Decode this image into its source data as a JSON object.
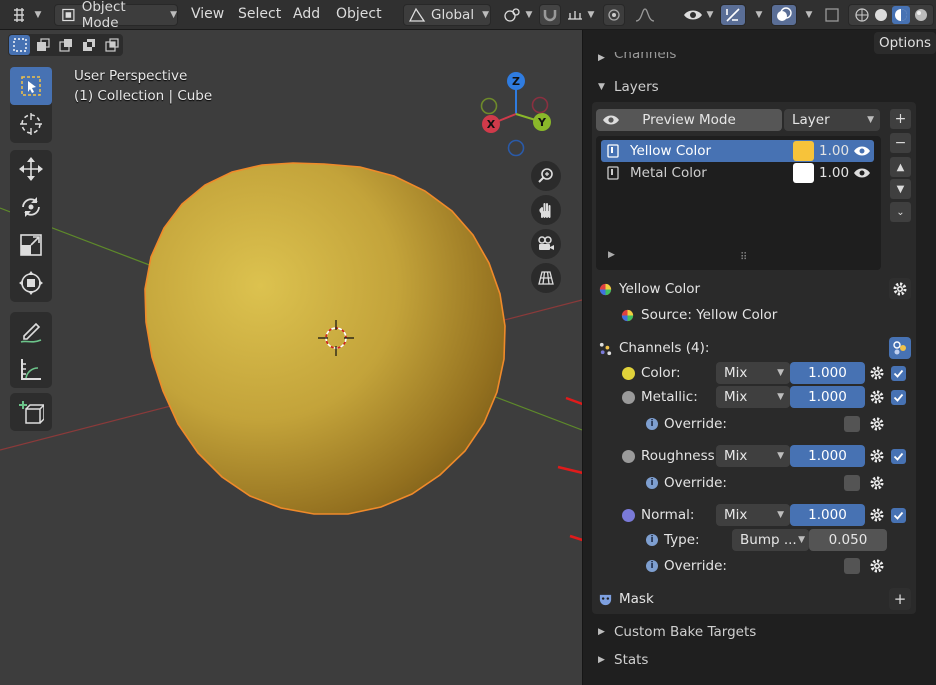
{
  "header": {
    "mode_label": "Object Mode",
    "menus": [
      "View",
      "Select",
      "Add",
      "Object"
    ],
    "orientation_label": "Global"
  },
  "viewport": {
    "perspective_label": "User Perspective",
    "collection_label": "(1) Collection | Cube",
    "gizmo_axes": [
      "Z",
      "X",
      "Y"
    ]
  },
  "panel": {
    "options_label": "Options",
    "channels_top_label": "Channels",
    "layers_label": "Layers",
    "preview_mode_label": "Preview Mode",
    "layer_select_label": "Layer",
    "layers": [
      {
        "name": "Yellow Color",
        "opacity": "1.00",
        "swatch": "#f7c33a"
      },
      {
        "name": "Metal Color",
        "opacity": "1.00",
        "swatch": "#ffffff"
      }
    ],
    "active_layer_name": "Yellow Color",
    "source_label": "Source: Yellow Color",
    "channels_label": "Channels (4):",
    "channels": [
      {
        "name": "Color:",
        "blend": "Mix",
        "value": "1.000",
        "color": "#e0d23a"
      },
      {
        "name": "Metallic:",
        "blend": "Mix",
        "value": "1.000",
        "color": "#9a9a9a"
      },
      {
        "name": "Roughness:",
        "blend": "Mix",
        "value": "1.000",
        "color": "#9a9a9a"
      },
      {
        "name": "Normal:",
        "blend": "Mix",
        "value": "1.000",
        "color": "#7a7ad8"
      }
    ],
    "override_label": "Override:",
    "type_label": "Type:",
    "type_value": "Bump ...",
    "type_amount": "0.050",
    "mask_label": "Mask",
    "custom_bake_label": "Custom Bake Targets",
    "stats_label": "Stats"
  },
  "colors": {
    "accent_blue": "#4772b3",
    "sphere_yellow": "#c9a83a",
    "arrow_red": "#e01b1b"
  }
}
